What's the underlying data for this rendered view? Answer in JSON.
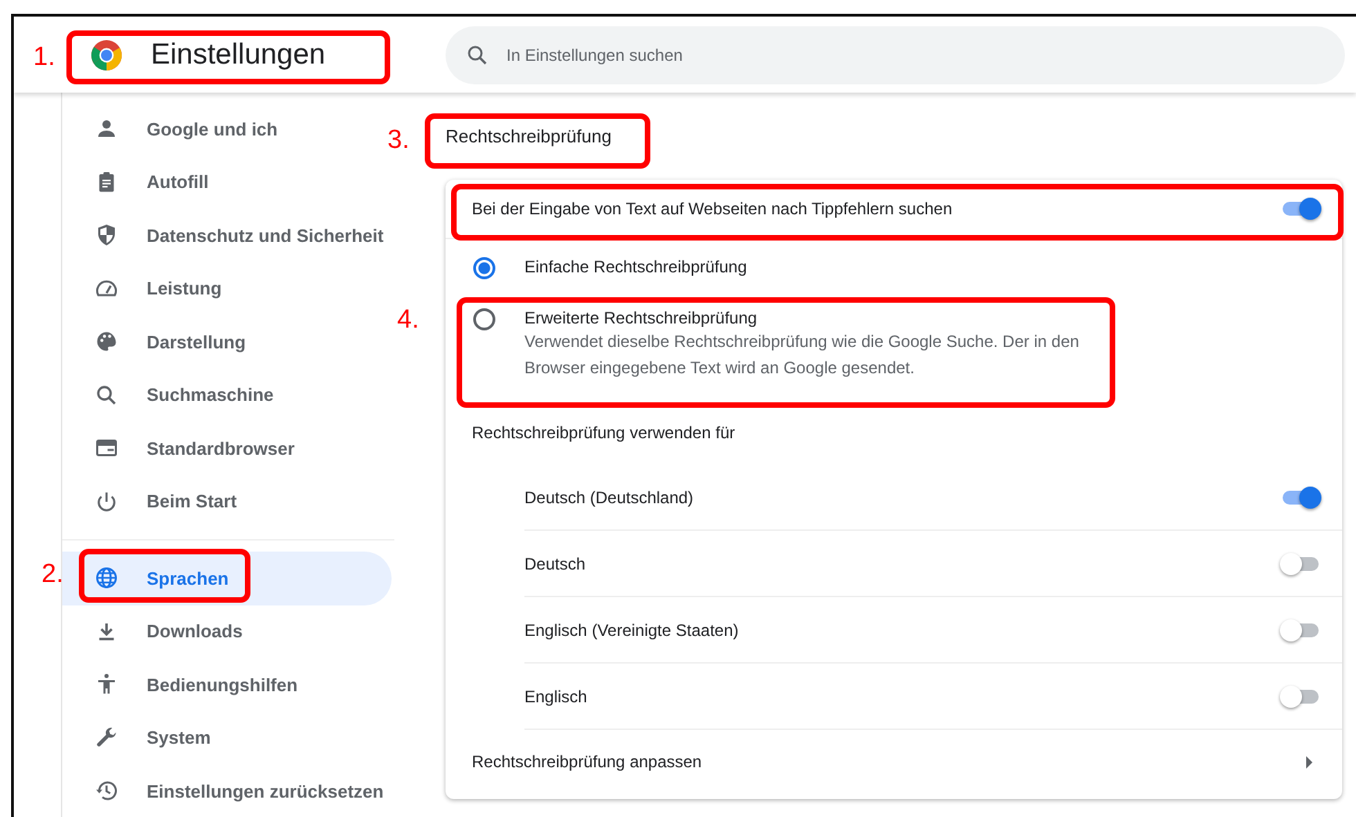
{
  "window": {
    "title": "Einstellungen"
  },
  "search": {
    "placeholder": "In Einstellungen suchen"
  },
  "sidebar": {
    "groups": [
      [
        {
          "label": "Google und ich",
          "selected": false
        },
        {
          "label": "Autofill",
          "selected": false
        },
        {
          "label": "Datenschutz und Sicherheit",
          "selected": false
        },
        {
          "label": "Leistung",
          "selected": false
        },
        {
          "label": "Darstellung",
          "selected": false
        },
        {
          "label": "Suchmaschine",
          "selected": false
        },
        {
          "label": "Standardbrowser",
          "selected": false
        },
        {
          "label": "Beim Start",
          "selected": false
        }
      ],
      [
        {
          "label": "Sprachen",
          "selected": true
        },
        {
          "label": "Downloads",
          "selected": false
        },
        {
          "label": "Bedienungshilfen",
          "selected": false
        },
        {
          "label": "System",
          "selected": false
        },
        {
          "label": "Einstellungen zurücksetzen",
          "selected": false
        }
      ]
    ]
  },
  "main": {
    "heading": "Rechtschreibprüfung",
    "check_row": {
      "label": "Bei der Eingabe von Text auf Webseiten nach Tippfehlern suchen",
      "on": true
    },
    "modes": [
      {
        "label": "Einfache Rechtschreibprüfung",
        "selected": true
      },
      {
        "label": "Erweiterte Rechtschreibprüfung",
        "description": "Verwendet dieselbe Rechtschreibprüfung wie die Google Suche. Der in den Browser eingegebene Text wird an Google gesendet.",
        "selected": false
      }
    ],
    "languages_heading": "Rechtschreibprüfung verwenden für",
    "languages": [
      {
        "label": "Deutsch (Deutschland)",
        "on": true
      },
      {
        "label": "Deutsch",
        "on": false
      },
      {
        "label": "Englisch (Vereinigte Staaten)",
        "on": false
      },
      {
        "label": "Englisch",
        "on": false
      }
    ],
    "customize": {
      "label": "Rechtschreibprüfung anpassen"
    }
  },
  "annotations": [
    {
      "kind": "numbered",
      "label": "1."
    },
    {
      "kind": "numbered",
      "label": "3."
    },
    {
      "kind": "frame"
    },
    {
      "kind": "numbered",
      "label": "4."
    },
    {
      "kind": "numbered",
      "label": "2."
    }
  ]
}
